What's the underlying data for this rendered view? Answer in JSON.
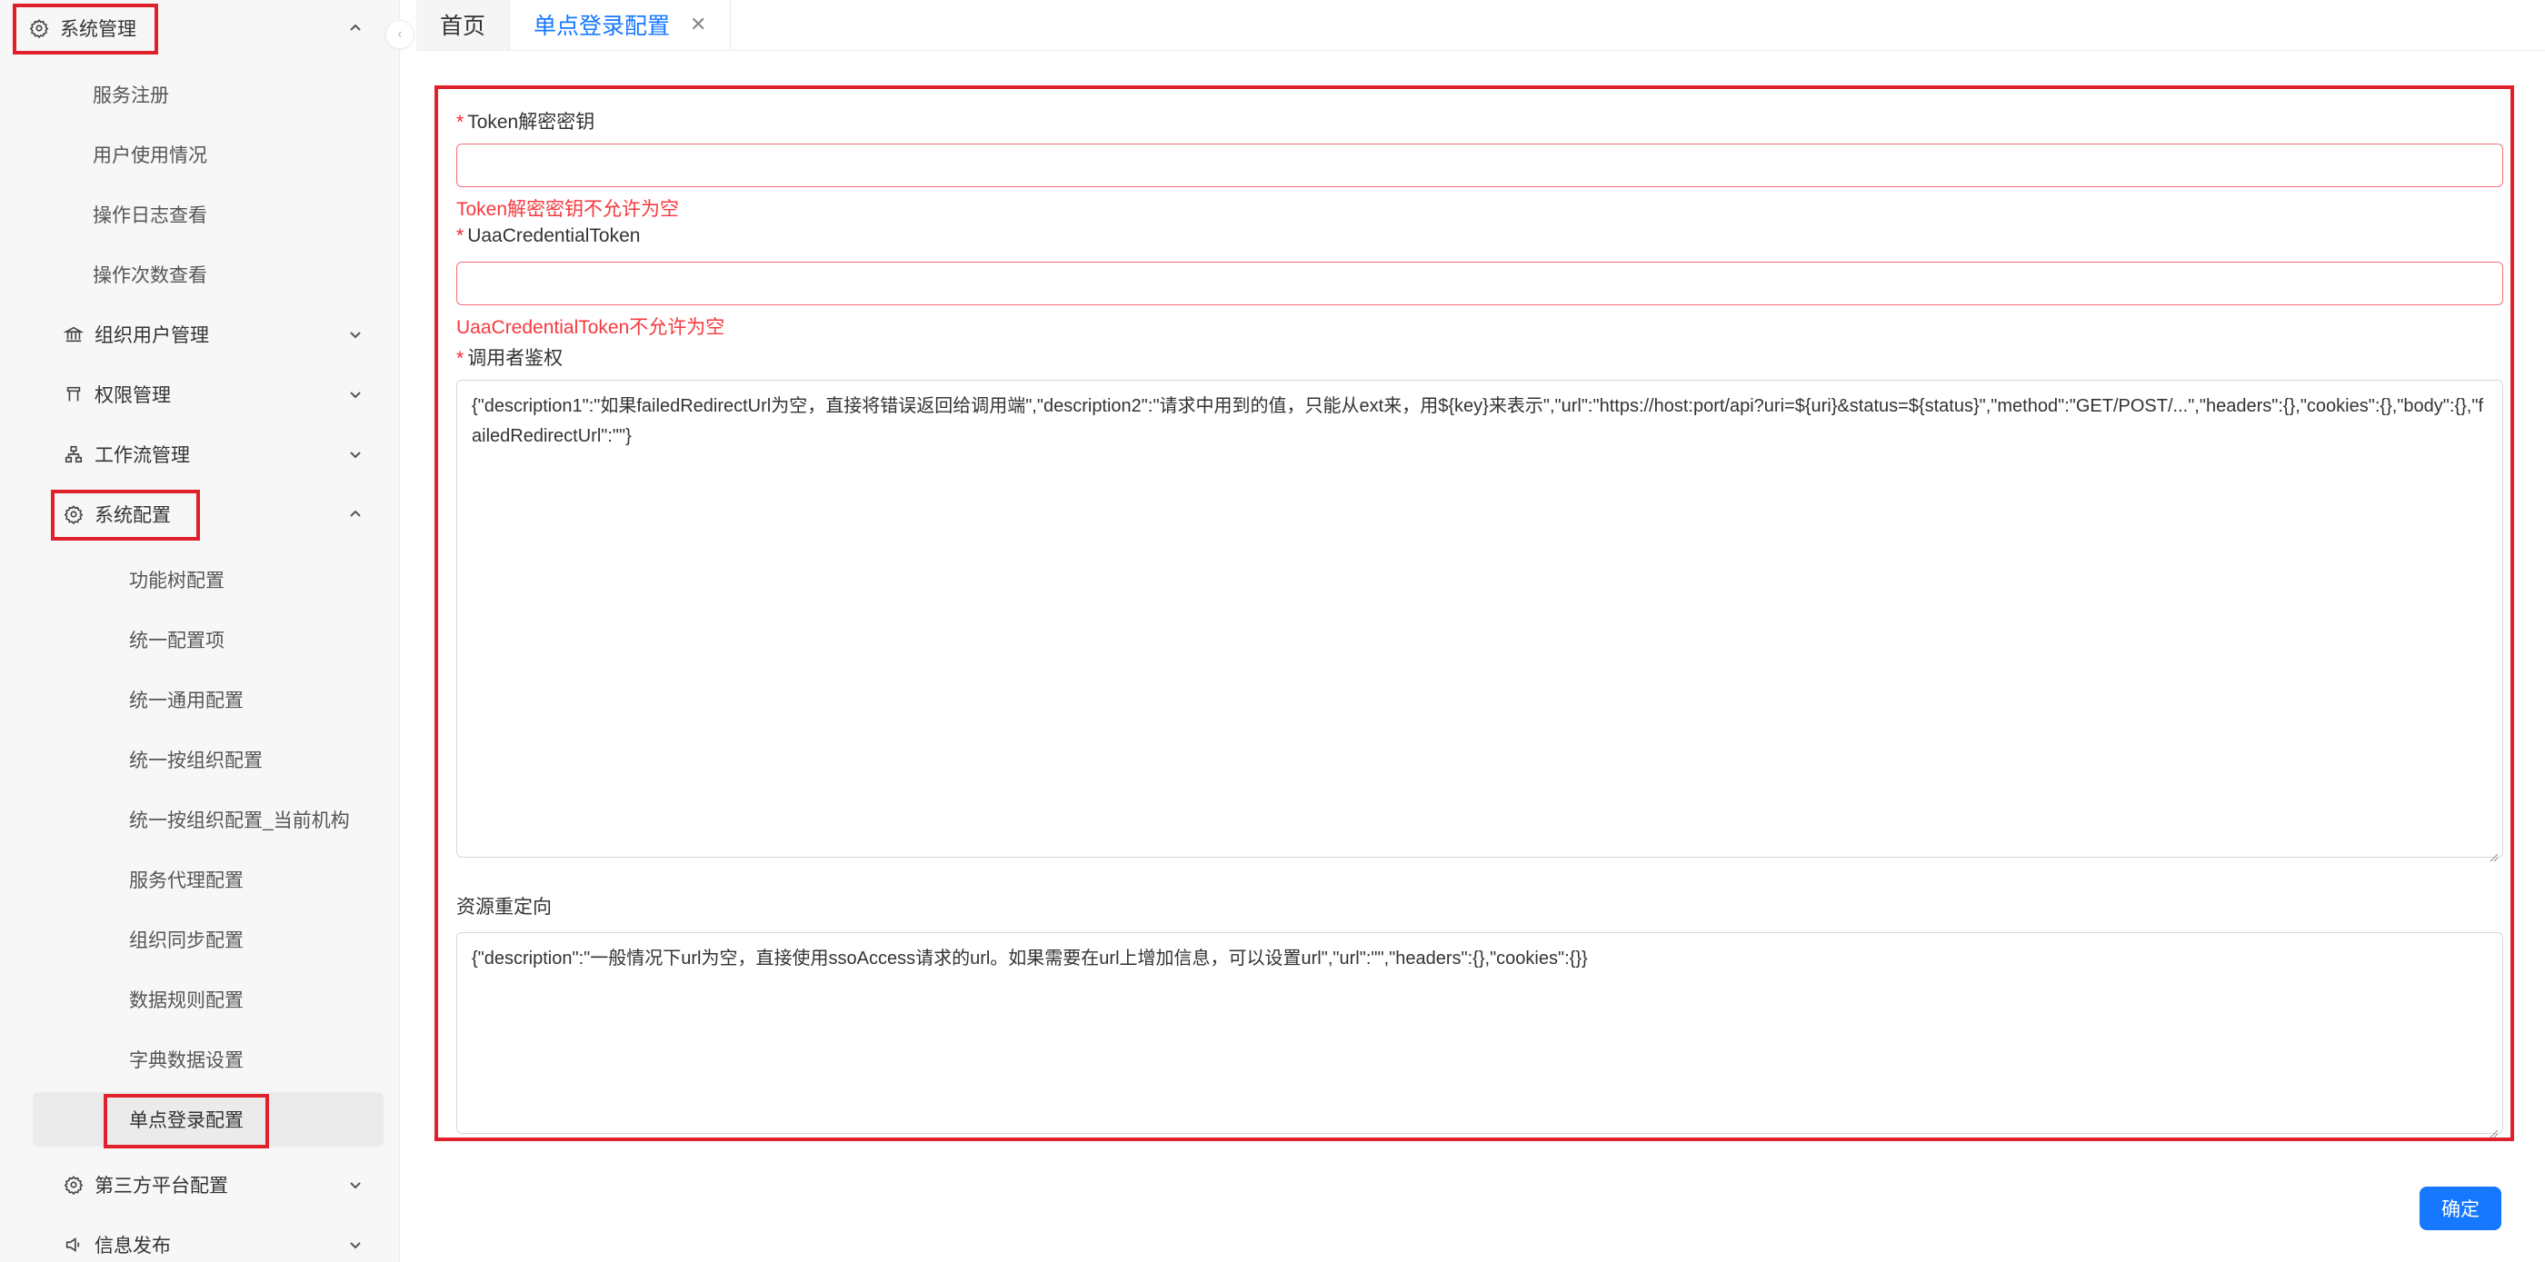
{
  "sidebar": {
    "system_mgmt": "系统管理",
    "service_register": "服务注册",
    "user_usage": "用户使用情况",
    "op_log": "操作日志查看",
    "op_count": "操作次数查看",
    "org_user_mgmt": "组织用户管理",
    "permission_mgmt": "权限管理",
    "workflow_mgmt": "工作流管理",
    "system_config": "系统配置",
    "config_items": [
      "功能树配置",
      "统一配置项",
      "统一通用配置",
      "统一按组织配置",
      "统一按组织配置_当前机构",
      "服务代理配置",
      "组织同步配置",
      "数据规则配置",
      "字典数据设置",
      "单点登录配置"
    ],
    "third_party": "第三方平台配置",
    "info_publish": "信息发布"
  },
  "tabs": {
    "home": "首页",
    "sso": "单点登录配置",
    "close": "✕"
  },
  "form": {
    "required_mark": "*",
    "token_label": "Token解密密钥",
    "token_value": "",
    "token_error": "Token解密密钥不允许为空",
    "uaa_label": "UaaCredentialToken",
    "uaa_value": "",
    "uaa_error": "UaaCredentialToken不允许为空",
    "caller_label": "调用者鉴权",
    "caller_value": "{\"description1\":\"如果failedRedirectUrl为空，直接将错误返回给调用端\",\"description2\":\"请求中用到的值，只能从ext来，用${key}来表示\",\"url\":\"https://host:port/api?uri=${uri}&status=${status}\",\"method\":\"GET/POST/...\",\"headers\":{},\"cookies\":{},\"body\":{},\"failedRedirectUrl\":\"\"}",
    "redirect_label": "资源重定向",
    "redirect_value": "{\"description\":\"一般情况下url为空，直接使用ssoAccess请求的url。如果需要在url上增加信息，可以设置url\",\"url\":\"\",\"headers\":{},\"cookies\":{}}",
    "confirm": "确定"
  },
  "colors": {
    "highlight": "#e0202a",
    "primary": "#1677ff",
    "error": "#f5393f"
  }
}
